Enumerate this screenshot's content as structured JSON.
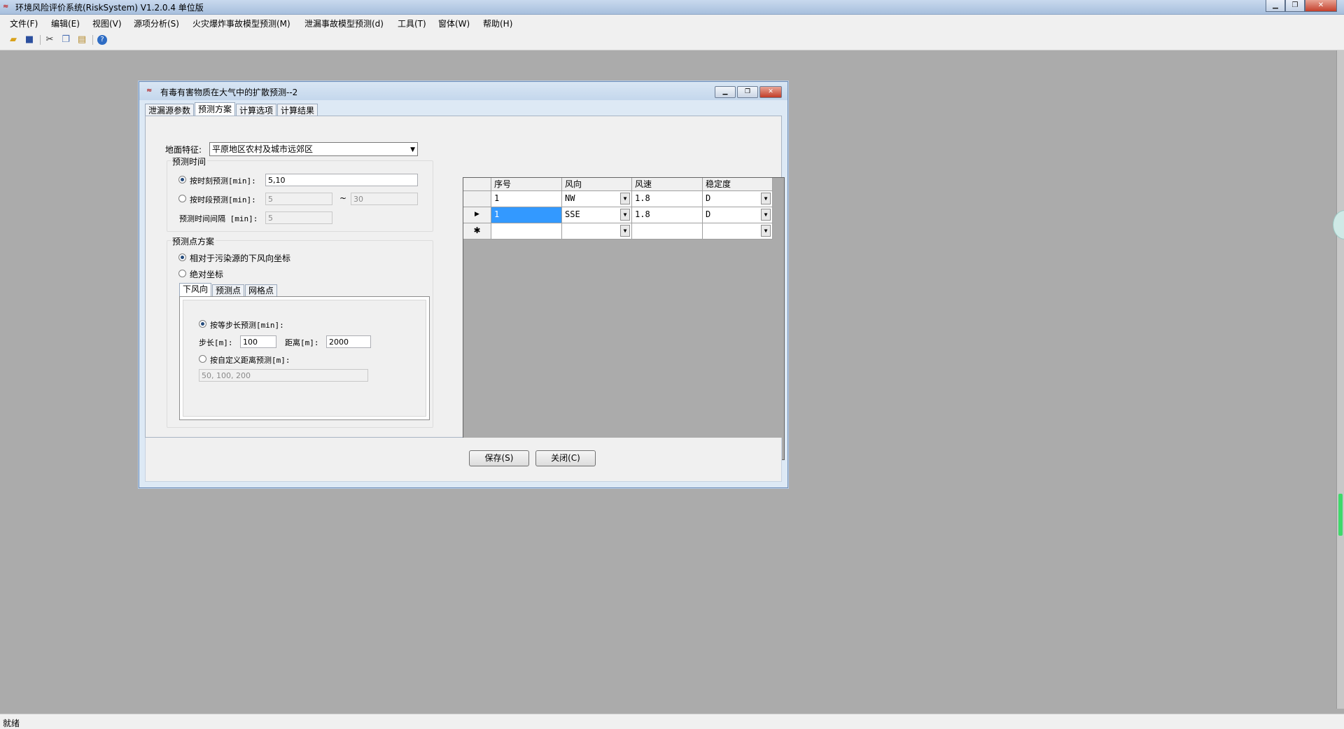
{
  "window": {
    "title": "环境风险评价系统(RiskSystem) V1.2.0.4 单位版",
    "icon": "app-logo-icon",
    "controls": [
      "minimize-icon",
      "maximize-icon",
      "close-icon"
    ]
  },
  "menu": [
    "文件(F)",
    "编辑(E)",
    "视图(V)",
    "源项分析(S)",
    "火灾爆炸事故模型预测(M)",
    "泄漏事故模型预测(d)",
    "工具(T)",
    "窗体(W)",
    "帮助(H)"
  ],
  "toolbar": {
    "icons": [
      "open-folder-icon",
      "save-icon",
      "cut-icon",
      "copy-icon",
      "paste-icon",
      "help-icon"
    ]
  },
  "status": "就绪",
  "dialog": {
    "title": "有毒有害物质在大气中的扩散预测--2",
    "tabs": [
      "泄漏源参数",
      "预测方案",
      "计算选项",
      "计算结果"
    ],
    "active_tab": 1,
    "ground_label": "地面特征:",
    "ground_value": "平原地区农村及城市远郊区",
    "time_group": "预测时间",
    "by_moment_label": "按时刻预测[min]:",
    "by_moment_value": "5,10",
    "by_period_label": "按时段预测[min]:",
    "period_from": "5",
    "tilde": "~",
    "period_to": "30",
    "interval_label": "预测时间间隔 [min]:",
    "interval_value": "5",
    "point_group": "预测点方案",
    "relative_label": "相对于污染源的下风向坐标",
    "absolute_label": "绝对坐标",
    "sub_tabs": [
      "下风向",
      "预测点",
      "网格点"
    ],
    "equal_step_label": "按等步长预测[min]:",
    "step_label": "步长[m]:",
    "step_value": "100",
    "distance_label": "距离[m]:",
    "distance_value": "2000",
    "custom_label": "按自定义距离预测[m]:",
    "custom_value": "50, 100, 200",
    "save_button": "保存(S)",
    "close_button": "关闭(C)"
  },
  "grid": {
    "columns": [
      "序号",
      "风向",
      "风速",
      "稳定度"
    ],
    "rows": [
      {
        "marker": "",
        "no": "1",
        "dir": "NW",
        "speed": "1.8",
        "stab": "D"
      },
      {
        "marker": "▶",
        "no": "1",
        "dir": "SSE",
        "speed": "1.8",
        "stab": "D"
      },
      {
        "marker": "✱",
        "no": "",
        "dir": "",
        "speed": "",
        "stab": ""
      }
    ]
  }
}
